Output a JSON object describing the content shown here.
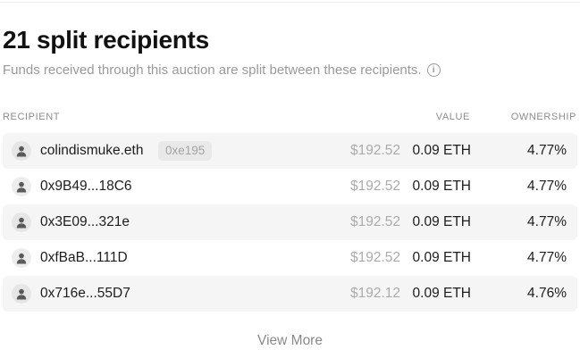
{
  "header": {
    "title": "21 split recipients",
    "subtitle": "Funds received through this auction are split between these recipients.",
    "info_icon": "info-icon"
  },
  "table": {
    "columns": {
      "recipient": "RECIPIENT",
      "value": "VALUE",
      "ownership": "OWNERSHIP"
    },
    "rows": [
      {
        "name": "colindismuke.eth",
        "address": "0xe195",
        "usd": "$192.52",
        "eth": "0.09 ETH",
        "ownership": "4.77%",
        "icon": "user-icon"
      },
      {
        "name": "0x9B49...18C6",
        "address": "",
        "usd": "$192.52",
        "eth": "0.09 ETH",
        "ownership": "4.77%",
        "icon": "user-icon"
      },
      {
        "name": "0x3E09...321e",
        "address": "",
        "usd": "$192.52",
        "eth": "0.09 ETH",
        "ownership": "4.77%",
        "icon": "user-icon"
      },
      {
        "name": "0xfBaB...111D",
        "address": "",
        "usd": "$192.52",
        "eth": "0.09 ETH",
        "ownership": "4.77%",
        "icon": "user-icon"
      },
      {
        "name": "0x716e...55D7",
        "address": "",
        "usd": "$192.12",
        "eth": "0.09 ETH",
        "ownership": "4.76%",
        "icon": "user-icon"
      }
    ]
  },
  "footer": {
    "view_more_label": "View More"
  }
}
